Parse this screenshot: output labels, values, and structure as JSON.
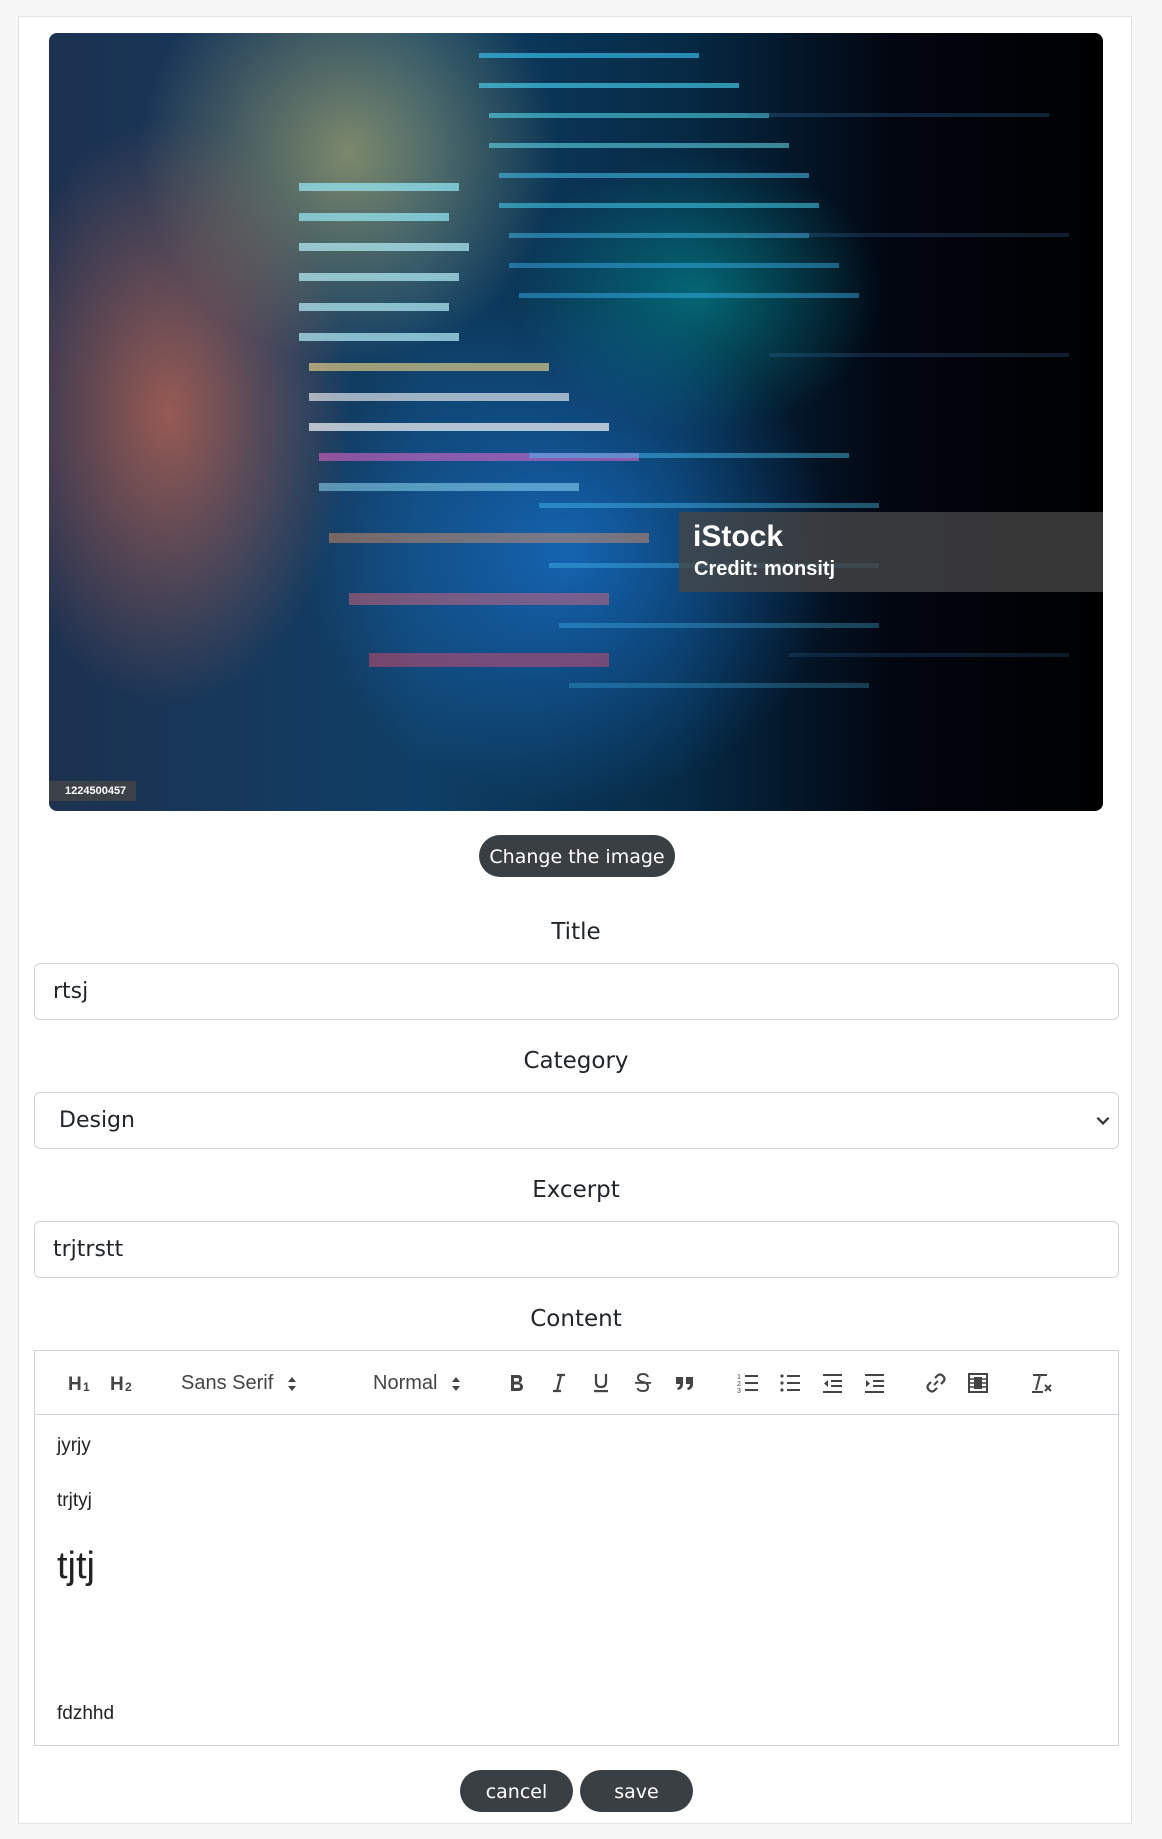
{
  "hero_image": {
    "watermark_brand": "iStock",
    "watermark_credit": "Credit: monsitj",
    "stock_id": "1224500457"
  },
  "change_image_label": "Change the image",
  "title": {
    "label": "Title",
    "value": "rtsj"
  },
  "category": {
    "label": "Category",
    "selected": "Design"
  },
  "excerpt": {
    "label": "Excerpt",
    "value": "trjtrstt"
  },
  "content": {
    "label": "Content",
    "toolbar": {
      "font_picker": "Sans Serif",
      "size_picker": "Normal",
      "icons": [
        "h1-icon",
        "h2-icon",
        "bold-icon",
        "italic-icon",
        "underline-icon",
        "strike-icon",
        "blockquote-icon",
        "ordered-list-icon",
        "bullet-list-icon",
        "outdent-icon",
        "indent-icon",
        "link-icon",
        "video-icon",
        "clean-format-icon"
      ]
    },
    "body": {
      "p1": "jyrjy",
      "p2": "trjtyj",
      "heading": "tjtj",
      "p3": "fdzhhd"
    }
  },
  "actions": {
    "cancel": "cancel",
    "save": "save"
  }
}
